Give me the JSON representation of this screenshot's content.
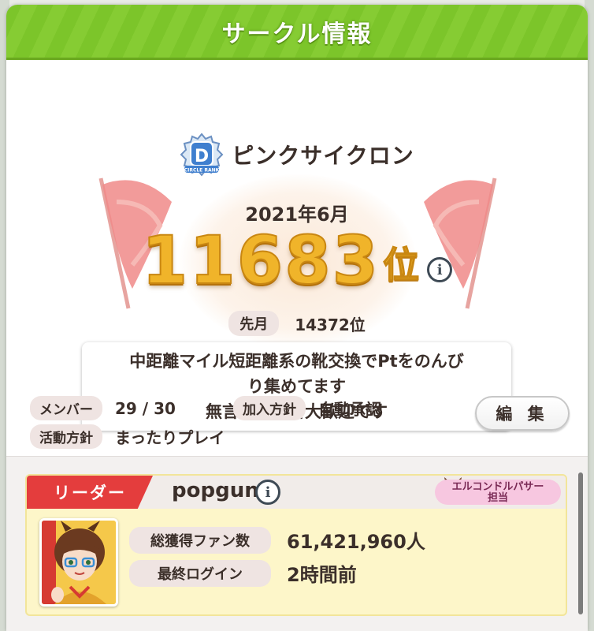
{
  "header": {
    "title": "サークル情報"
  },
  "circle": {
    "name": "ピンクサイクロン",
    "rank_badge": "D",
    "rank_badge_caption": "CIRCLE RANK",
    "month": "2021年6月",
    "rank": "11683",
    "rank_unit": "位",
    "prev_label": "先月",
    "prev_value": "14372位",
    "description": "中距離マイル短距離系の靴交換でPtをのんび\nり集めてます\n無言、初心者大歓迎です"
  },
  "meta": {
    "members_label": "メンバー",
    "members_value": "29 / 30",
    "join_label": "加入方針",
    "join_value": "自動承認",
    "activity_label": "活動方針",
    "activity_value": "まったりプレイ",
    "edit_label": "編 集"
  },
  "leader": {
    "tag": "リーダー",
    "name": "popgun",
    "trainer_line1": "エルコンドルパサー",
    "trainer_line2": "担当",
    "fans_label": "総獲得ファン数",
    "fans_value": "61,421,960人",
    "login_label": "最終ログイン",
    "login_value": "2時間前"
  },
  "icons": {
    "info": "info-icon",
    "rank_badge": "rank-d-badge-icon"
  },
  "colors": {
    "header_green": "#7cc52a",
    "rank_gold": "#f0b42a",
    "leader_red": "#e43d3d",
    "card_yellow": "#fdf6c9",
    "trainer_pink": "#f7c7e0"
  }
}
